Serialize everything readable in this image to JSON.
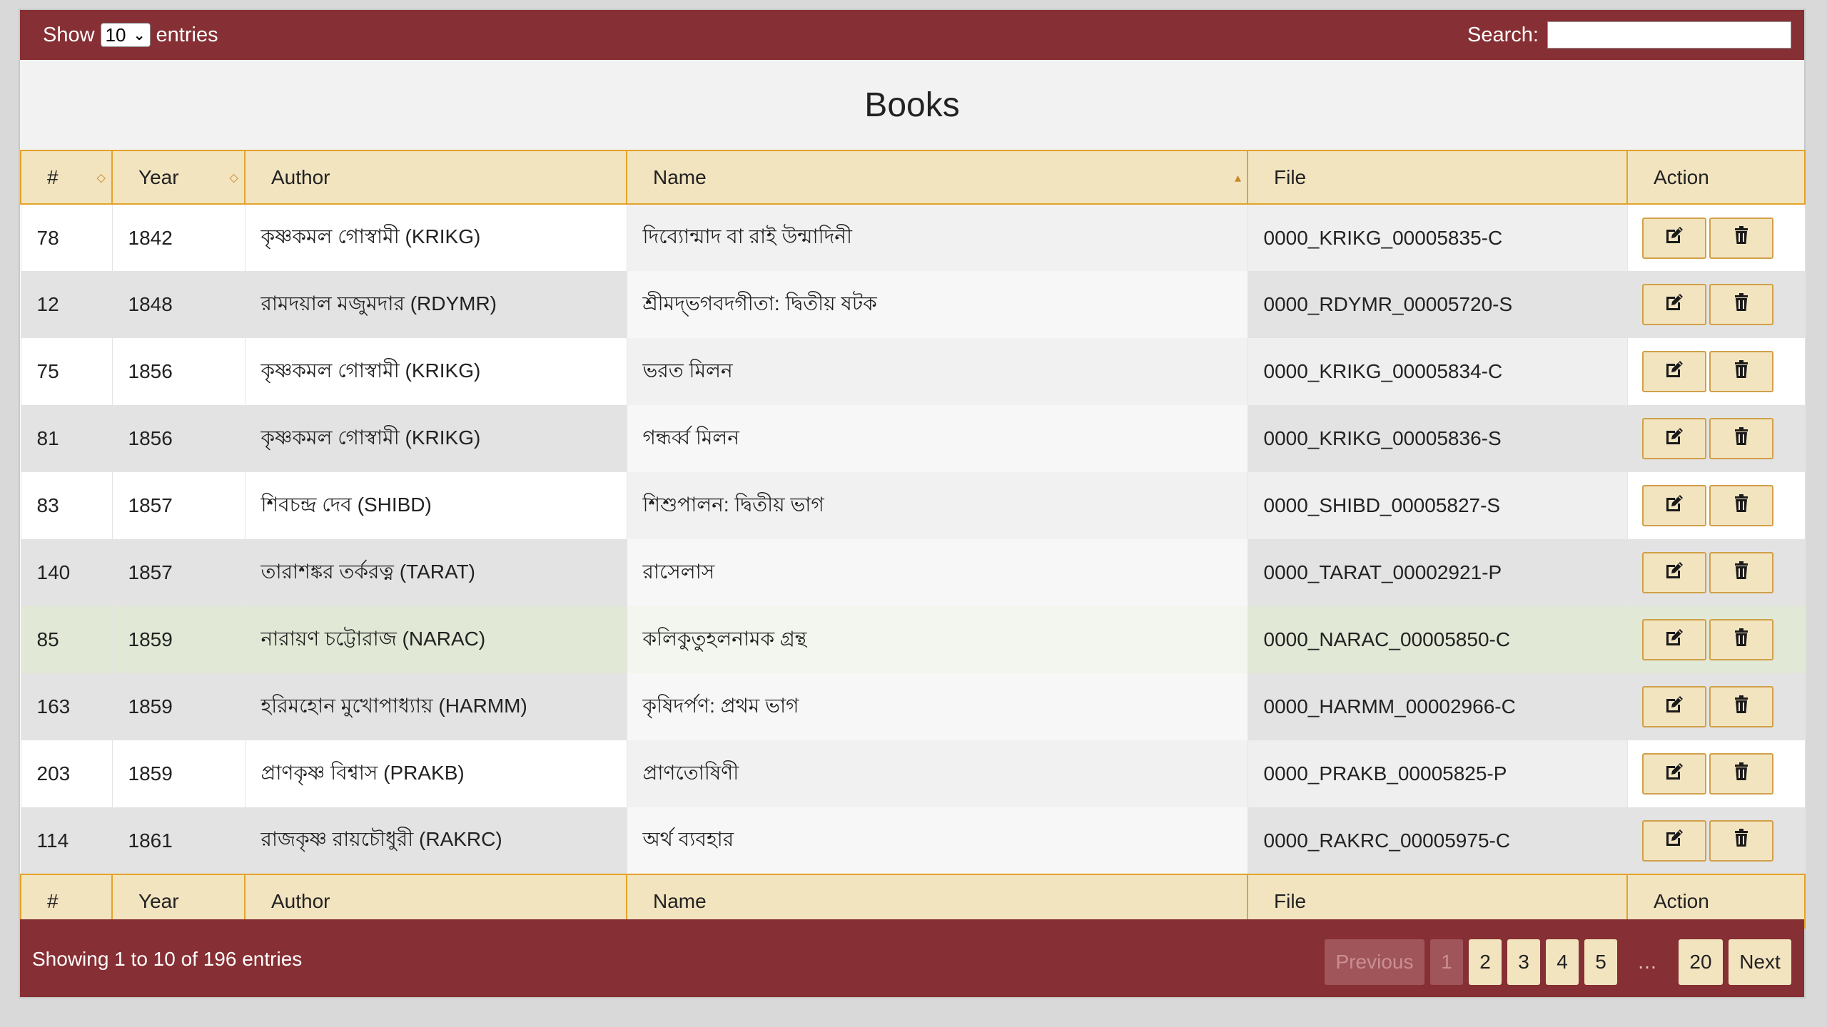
{
  "controls": {
    "show_label": "Show",
    "page_length": "10",
    "entries_label": "entries",
    "search_label": "Search:",
    "search_value": ""
  },
  "title": "Books",
  "columns": {
    "num": "#",
    "year": "Year",
    "author": "Author",
    "name": "Name",
    "file": "File",
    "action": "Action"
  },
  "sorting": {
    "column": "Name",
    "direction": "ascending"
  },
  "rows": [
    {
      "num": "78",
      "year": "1842",
      "author": "কৃষ্ণকমল গোস্বামী (KRIKG)",
      "name": "দিব্যোন্মাদ বা রাই উন্মাদিনী",
      "file": "0000_KRIKG_00005835-C"
    },
    {
      "num": "12",
      "year": "1848",
      "author": "রামদয়াল মজুমদার (RDYMR)",
      "name": "শ্রীমদ্‌ভগবদগীতা: দ্বিতীয় ষটক",
      "file": "0000_RDYMR_00005720-S"
    },
    {
      "num": "75",
      "year": "1856",
      "author": "কৃষ্ণকমল গোস্বামী (KRIKG)",
      "name": "ভরত মিলন",
      "file": "0000_KRIKG_00005834-C"
    },
    {
      "num": "81",
      "year": "1856",
      "author": "কৃষ্ণকমল গোস্বামী (KRIKG)",
      "name": "গন্ধৰ্ব্ব মিলন",
      "file": "0000_KRIKG_00005836-S"
    },
    {
      "num": "83",
      "year": "1857",
      "author": "শিবচন্দ্র দেব (SHIBD)",
      "name": "শিশুপালন: দ্বিতীয় ভাগ",
      "file": "0000_SHIBD_00005827-S"
    },
    {
      "num": "140",
      "year": "1857",
      "author": "তারাশঙ্কর তর্করত্ন (TARAT)",
      "name": "রাসেলাস",
      "file": "0000_TARAT_00002921-P"
    },
    {
      "num": "85",
      "year": "1859",
      "author": "নারায়ণ চট্টোরাজ (NARAC)",
      "name": "কলিকুতুহলনামক গ্রন্থ",
      "file": "0000_NARAC_00005850-C"
    },
    {
      "num": "163",
      "year": "1859",
      "author": "হরিমহোন মুখোপাধ্যায় (HARMM)",
      "name": "কৃষিদর্পণ: প্রথম ভাগ",
      "file": "0000_HARMM_00002966-C"
    },
    {
      "num": "203",
      "year": "1859",
      "author": "প্রাণকৃষ্ণ বিশ্বাস (PRAKB)",
      "name": "প্রাণতোষিণী",
      "file": "0000_PRAKB_00005825-P"
    },
    {
      "num": "114",
      "year": "1861",
      "author": "রাজকৃষ্ণ রায়চৌধুরী (RAKRC)",
      "name": "অর্থ ব্যবহার",
      "file": "0000_RAKRC_00005975-C"
    }
  ],
  "highlighted_row": "85",
  "icons": {
    "edit": "edit-icon",
    "delete": "trash-icon"
  },
  "info": "Showing 1 to 10 of 196 entries",
  "pagination": {
    "previous": "Previous",
    "pages": [
      "1",
      "2",
      "3",
      "4",
      "5"
    ],
    "ellipsis": "…",
    "last": "20",
    "next": "Next",
    "current": "1"
  },
  "colors": {
    "bar": "#862f34",
    "header_fill": "#f3e4c0",
    "header_border": "#e2a32c",
    "highlight_row": "#e1e8d6"
  }
}
